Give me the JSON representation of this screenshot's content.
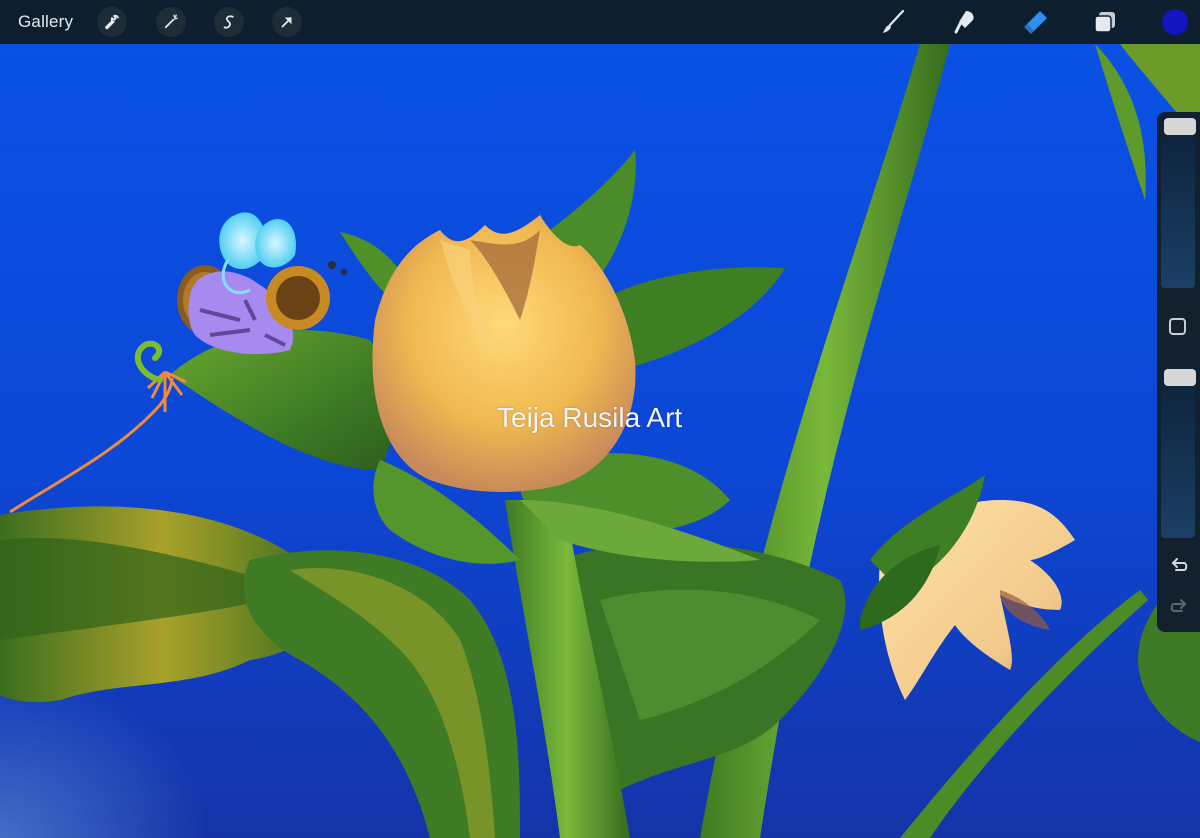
{
  "toolbar": {
    "gallery_label": "Gallery",
    "left_tools": [
      "wrench-icon",
      "magic-wand-icon",
      "selection-icon",
      "transform-arrow-icon"
    ],
    "right_tools": [
      "brush-icon",
      "smudge-icon",
      "eraser-icon",
      "layers-icon"
    ],
    "active_tool": "eraser",
    "current_color": "#1414c0"
  },
  "sidebar": {
    "brush_size_slider": "brush-size",
    "opacity_slider": "opacity",
    "modify_button": "square-icon",
    "undo": "undo-arrow-icon",
    "redo": "redo-arrow-icon"
  },
  "canvas": {
    "watermark": "Teija Rusila Art",
    "background_color": "#0b45d8"
  }
}
